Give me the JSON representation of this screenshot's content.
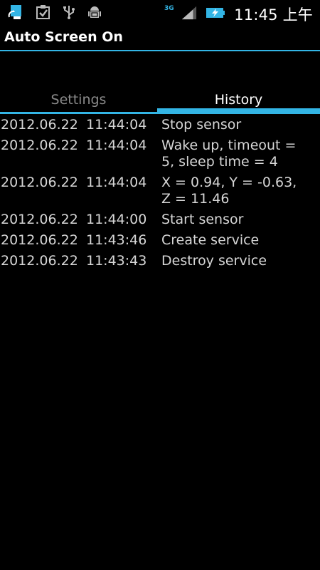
{
  "status_bar": {
    "icons_left": [
      "sync-icon",
      "checkbox-icon",
      "usb-icon",
      "android-debug-icon"
    ],
    "network": "3G",
    "clock": "11:45 上午"
  },
  "title_bar": {
    "title": "Auto Screen On"
  },
  "tabs": [
    {
      "label": "Settings",
      "selected": false
    },
    {
      "label": "History",
      "selected": true
    }
  ],
  "history": [
    {
      "date": "2012.06.22",
      "time": "11:44:04",
      "message": "Stop sensor"
    },
    {
      "date": "2012.06.22",
      "time": "11:44:04",
      "message": "Wake up, timeout = 5, sleep time = 4"
    },
    {
      "date": "2012.06.22",
      "time": "11:44:04",
      "message": "X = 0.94, Y = -0.63, Z = 11.46"
    },
    {
      "date": "2012.06.22",
      "time": "11:44:00",
      "message": "Start sensor"
    },
    {
      "date": "2012.06.22",
      "time": "11:43:46",
      "message": "Create service"
    },
    {
      "date": "2012.06.22",
      "time": "11:43:43",
      "message": "Destroy service"
    }
  ],
  "colors": {
    "accent": "#33b5e5",
    "background": "#000000",
    "text": "#d6d6d6",
    "inactive_tab": "#8a8a8a"
  }
}
